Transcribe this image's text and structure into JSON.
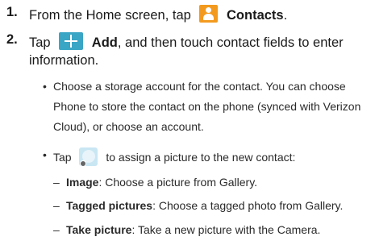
{
  "steps": [
    {
      "number": "1.",
      "pre": "From the Home screen, tap",
      "icon": "contacts-icon",
      "label": "Contacts",
      "post": "."
    },
    {
      "number": "2.",
      "pre": "Tap",
      "icon": "add-icon",
      "label": "Add",
      "post": ", and then touch contact fields to enter",
      "line2": "information."
    }
  ],
  "bullets": [
    {
      "lines": [
        "Choose a storage account for the contact. You can choose",
        "Phone to store the contact on the phone (synced with Verizon",
        "Cloud), or choose an account."
      ]
    },
    {
      "pre": "Tap",
      "icon": "contact-picture-icon",
      "post": "to assign a picture to the new contact:"
    }
  ],
  "sub_items": [
    {
      "label": "Image",
      "desc": ": Choose a picture from Gallery."
    },
    {
      "label": "Tagged pictures",
      "desc": ": Choose a tagged photo from Gallery."
    },
    {
      "label": "Take picture",
      "desc": ": Take a new picture with the Camera."
    }
  ],
  "symbols": {
    "bullet": "•",
    "dash": "–"
  },
  "colors": {
    "contacts_icon_bg": "#f39a1e",
    "add_icon_bg": "#3aa6c6",
    "text": "#1a1a1a"
  }
}
